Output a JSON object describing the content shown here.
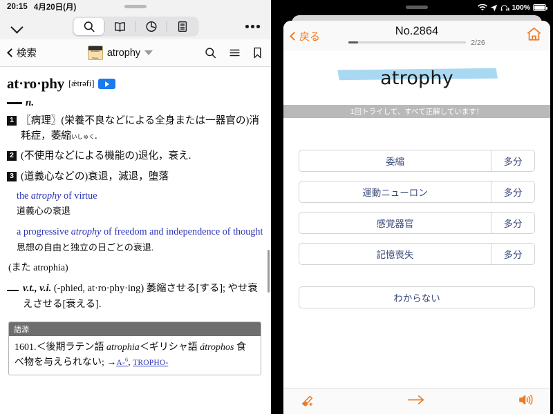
{
  "left": {
    "status": {
      "time": "20:15",
      "date": "4月20日(月)"
    },
    "toolbar": {
      "collapse_icon": "chevron-down-icon",
      "segments": [
        {
          "icon": "search-icon",
          "selected": true
        },
        {
          "icon": "book-icon",
          "selected": false
        },
        {
          "icon": "history-clock-icon",
          "selected": false
        },
        {
          "icon": "list-document-icon",
          "selected": false
        }
      ],
      "more_icon": "more-dots-icon"
    },
    "navbar": {
      "back_label": "検索",
      "dict_badge_line1": "Random",
      "dict_badge_line2": "House",
      "headword_label": "atrophy",
      "dropdown_icon": "chevron-down-icon",
      "search_icon": "search-icon",
      "menu_icon": "hamburger-menu-icon",
      "bookmark_icon": "bookmark-icon"
    },
    "entry": {
      "headword": "at·ro·phy",
      "ipa": "[ǽtrəfi]",
      "audio_icon": "play-audio-icon",
      "pos": "n.",
      "senses": [
        {
          "num": "1",
          "text": "〖病理〗(栄養不良などによる全身または一器官の)消耗症，萎縮",
          "ruby": "いしゅく",
          "tail": "."
        },
        {
          "num": "2",
          "text": "(不使用などによる機能の)退化，衰え.",
          "ruby": "",
          "tail": ""
        },
        {
          "num": "3",
          "text": "(道義心などの)衰退，減退，堕落",
          "ruby": "",
          "tail": ""
        }
      ],
      "examples": [
        {
          "en_pre": "the ",
          "en_it": "atrophy",
          "en_post": " of virtue",
          "ja": "道義心の衰退"
        },
        {
          "en_pre": "a progressive ",
          "en_it": "atrophy",
          "en_post": " of freedom and independence of thought",
          "ja": "思想の自由と独立の日ごとの衰退."
        }
      ],
      "also": "(また atrophia)",
      "verb_pos": "v.t.,  v.i.",
      "verb_text": "(-phied,  at·ro·phy·ing) 萎縮させる[する]; やせ衰えさせる[衰える].",
      "etymology": {
        "header": "語源",
        "text_pre": "1601.＜後期ラテン語 ",
        "text_it1": "atrophia",
        "text_mid": "＜ギリシャ語 ",
        "text_it2": "átrophos",
        "text_post": " 食べ物を与えられない; →",
        "xref1": "A-",
        "xref1_sup": "6",
        "xref_sep": ",  ",
        "xref2": "TROPHO-"
      }
    }
  },
  "right": {
    "status": {
      "wifi_icon": "wifi-icon",
      "location_icon": "location-arrow-icon",
      "headphones_icon": "headphones-battery-icon",
      "battery_percent": "100%",
      "battery_icon": "battery-full-icon"
    },
    "navbar": {
      "back_label": "戻る",
      "back_icon": "chevron-left-icon",
      "title": "No.2864",
      "progress_percent": 8,
      "counter": "2/26",
      "home_icon": "home-icon"
    },
    "card": {
      "word": "atrophy",
      "highlighter": "marker-highlight",
      "banner": "1回トライして、すべて正解しています！"
    },
    "quiz": {
      "options": [
        {
          "label": "委縮",
          "side": "多分"
        },
        {
          "label": "運動ニューロン",
          "side": "多分"
        },
        {
          "label": "感覚器官",
          "side": "多分"
        },
        {
          "label": "記憶喪失",
          "side": "多分"
        }
      ],
      "dont_know_label": "わからない"
    },
    "toolbar": {
      "marker_icon": "highlighter-pen-icon",
      "next_icon": "arrow-right-icon",
      "speaker_icon": "speaker-volume-icon"
    }
  }
}
